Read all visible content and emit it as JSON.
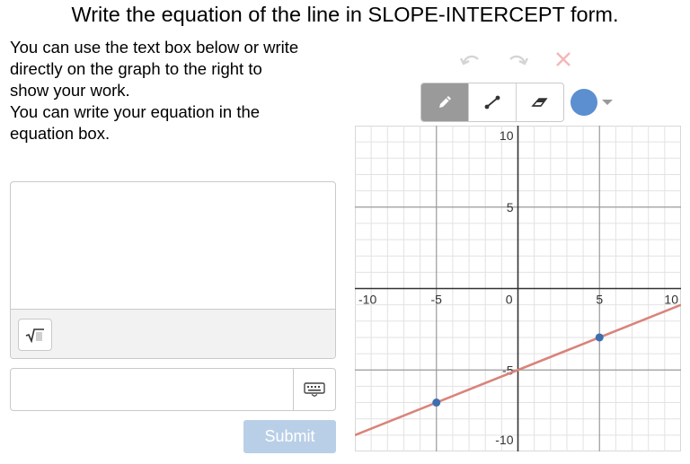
{
  "title": "Write the equation of the line in SLOPE-INTERCEPT form.",
  "instructions": [
    "You can use the text box below or write",
    "directly on the graph to the right to",
    "show your work.",
    "You can write your equation in the",
    "equation box."
  ],
  "work_area": {
    "value": "",
    "math_button_icon": "square-root-icon"
  },
  "equation_box": {
    "value": "",
    "keyboard_icon": "keyboard-icon"
  },
  "submit_label": "Submit",
  "graph_toolbar": {
    "undo_icon": "undo-icon",
    "redo_icon": "redo-icon",
    "clear_icon": "close-icon",
    "tools": [
      "pencil-icon",
      "line-segment-icon",
      "eraser-icon"
    ],
    "active_tool": "pencil-icon",
    "selected_color": "#5b8fcf"
  },
  "chart_data": {
    "type": "scatter",
    "xlim": [
      -10,
      10
    ],
    "ylim": [
      -10,
      10
    ],
    "grid": true,
    "x_ticks": [
      "-10",
      "-5",
      "0",
      "5",
      "10"
    ],
    "y_ticks": [
      "10",
      "5",
      "-5",
      "-10"
    ],
    "points": [
      {
        "x": -5,
        "y": -7
      },
      {
        "x": 5,
        "y": -3
      }
    ],
    "line": {
      "slope": 0.4,
      "intercept": -5,
      "color": "#d9837b"
    },
    "point_color": "#3d6fb0"
  },
  "colors": {
    "accent": "#5b8fcf",
    "submit_bg": "#b9cfe7",
    "border": "#c9c9c9"
  }
}
